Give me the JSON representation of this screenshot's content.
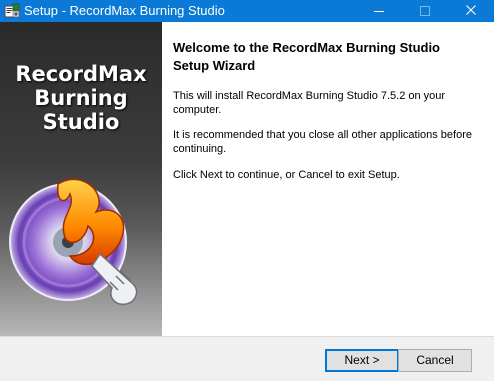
{
  "window": {
    "title": "Setup - RecordMax Burning Studio"
  },
  "title_bar": {
    "icons": {
      "app": "setup-app-icon",
      "minimize": "minimize-icon",
      "maximize": "maximize-icon",
      "close": "close-icon"
    }
  },
  "banner": {
    "title_line1": "RecordMax",
    "title_line2": "Burning Studio",
    "art": "disc-flame-logo"
  },
  "content": {
    "heading": "Welcome to the RecordMax Burning Studio Setup Wizard",
    "paragraphs": [
      "This will install RecordMax Burning Studio 7.5.2 on your computer.",
      "It is recommended that you close all other applications before continuing.",
      "Click Next to continue, or Cancel to exit Setup."
    ]
  },
  "buttons": {
    "next": "Next >",
    "cancel": "Cancel"
  },
  "colors": {
    "title_bar": "#0a7ad6",
    "default_button_border": "#0078d7",
    "content_bg": "#ffffff",
    "footer_bg": "#f0f0f0"
  }
}
